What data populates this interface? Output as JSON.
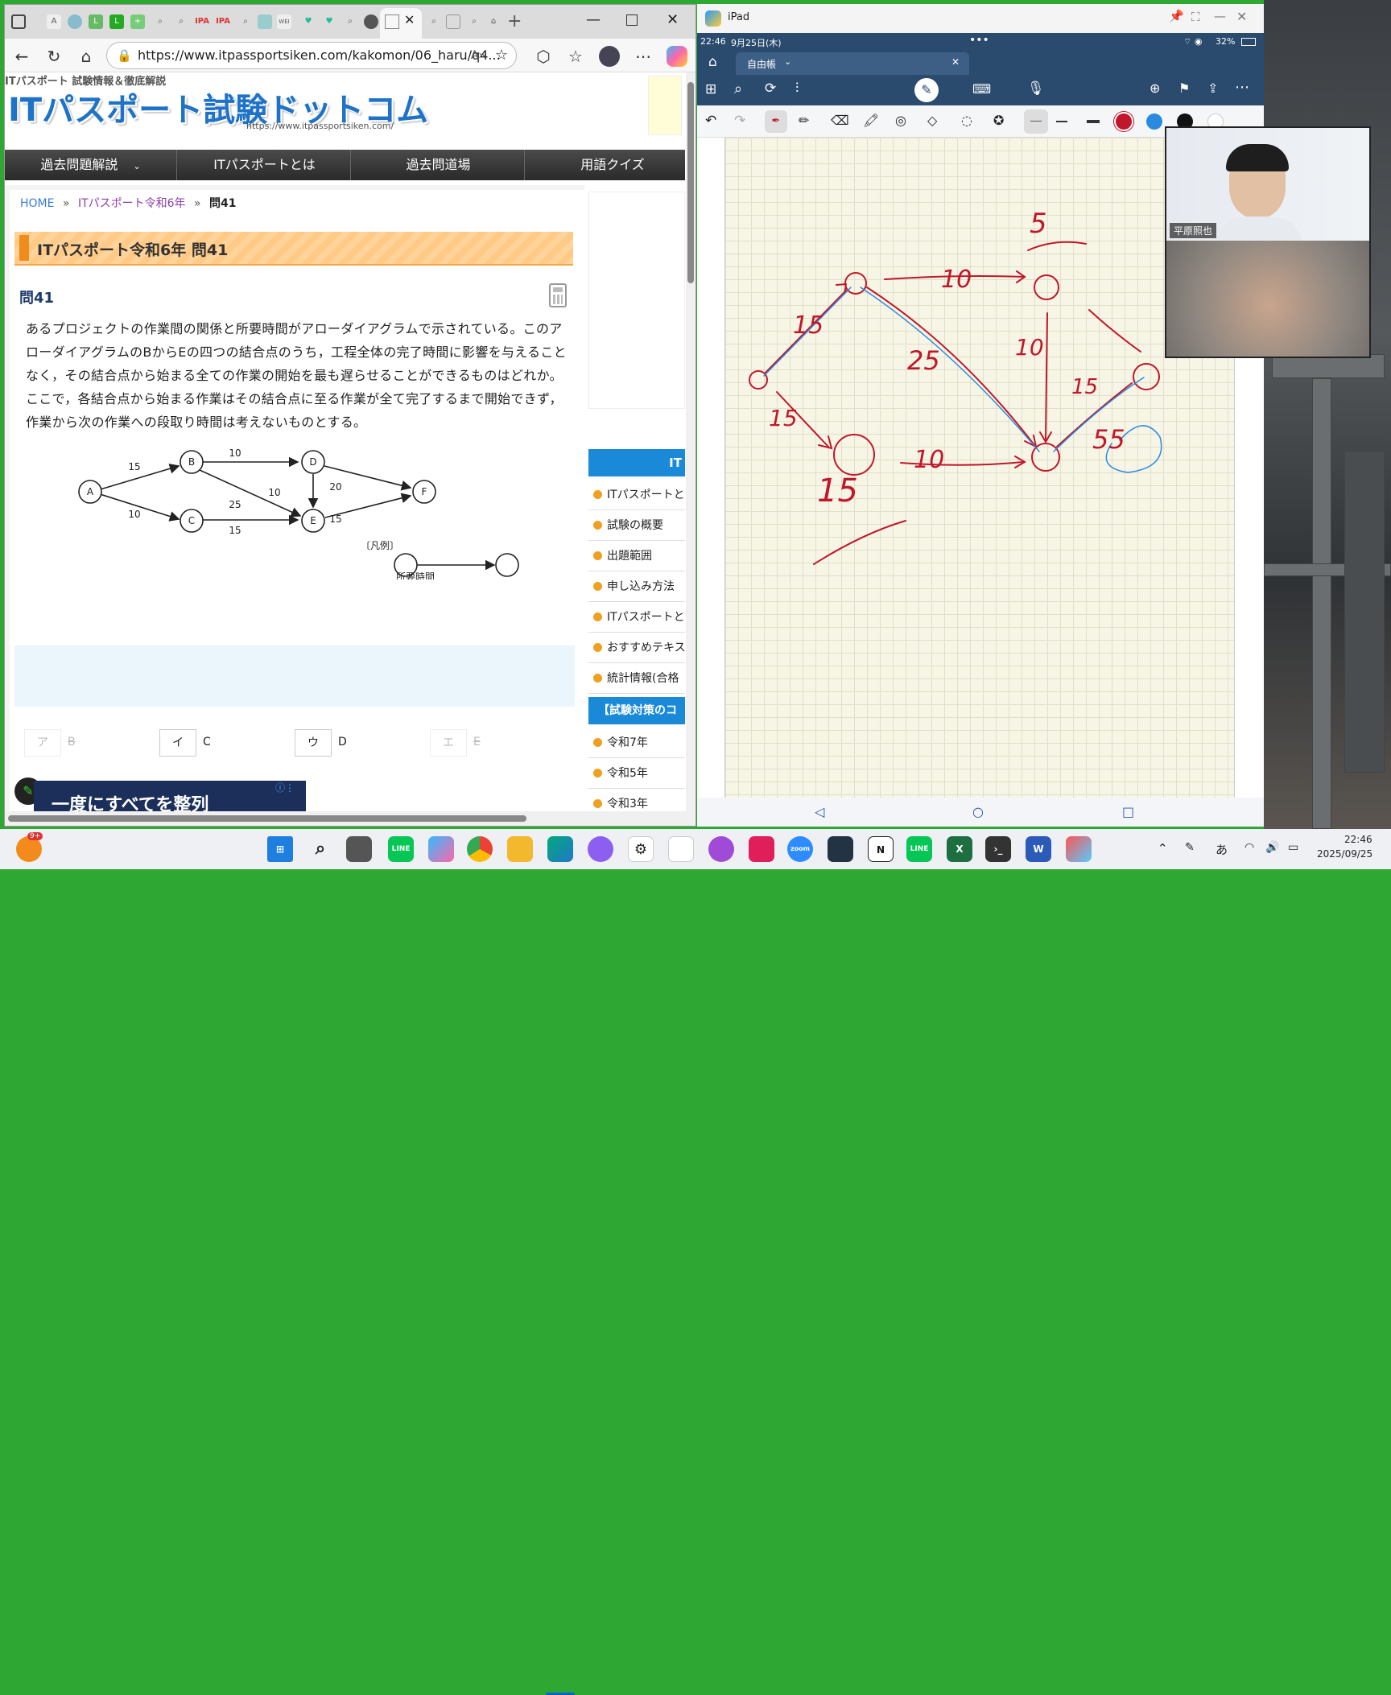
{
  "browser": {
    "url": "https://www.itpassportsiken.com/kakomon/06_haru/q4...",
    "tabs": [
      "A",
      "",
      "L",
      "L",
      "",
      "",
      "",
      "IPA",
      "IPA",
      "",
      "",
      "WEI",
      "",
      "",
      "",
      "",
      "",
      "",
      "",
      "",
      "",
      "",
      ""
    ]
  },
  "site": {
    "tagline": "ITパスポート 試験情報＆徹底解説",
    "logo": "ITパスポート試験ドットコム",
    "logo_url": "https://www.itpassportsiken.com/",
    "nav": [
      "過去問題解説",
      "ITパスポートとは",
      "過去問道場",
      "用語クイズ"
    ],
    "breadcrumb": {
      "home": "HOME",
      "sep1": "»",
      "section": "ITパスポート令和6年",
      "sep2": "»",
      "current": "問41"
    },
    "heading": "ITパスポート令和6年 問41",
    "question_no": "問41",
    "question_text": "あるプロジェクトの作業間の関係と所要時間がアローダイアグラムで示されている。このアローダイアグラムのBからEの四つの結合点のうち，工程全体の完了時間に影響を与えることなく，その結合点から始まる全ての作業の開始を最も遅らせることができるものはどれか。ここで，各結合点から始まる作業はその結合点に至る作業が全て完了するまで開始できず，作業から次の作業への段取り時間は考えないものとする。",
    "diagram": {
      "nodes": [
        "A",
        "B",
        "C",
        "D",
        "E",
        "F"
      ],
      "edges": [
        {
          "from": "A",
          "to": "B",
          "label": "15"
        },
        {
          "from": "A",
          "to": "C",
          "label": "10"
        },
        {
          "from": "B",
          "to": "D",
          "label": "10"
        },
        {
          "from": "B",
          "to": "E",
          "label": "25"
        },
        {
          "from": "C",
          "to": "E",
          "label": "15"
        },
        {
          "from": "D",
          "to": "E",
          "label": "10"
        },
        {
          "from": "D",
          "to": "F",
          "label": "20"
        },
        {
          "from": "E",
          "to": "F",
          "label": "15"
        }
      ],
      "legend_title": "〔凡例〕",
      "legend_label": "所要時間"
    },
    "choices": [
      {
        "key": "ア",
        "label": "B"
      },
      {
        "key": "イ",
        "label": "C"
      },
      {
        "key": "ウ",
        "label": "D"
      },
      {
        "key": "エ",
        "label": "E"
      }
    ],
    "sidebar_head": "IT",
    "sidebar_items": [
      "ITパスポートと",
      "試験の概要",
      "出題範囲",
      "申し込み方法",
      "ITパスポートと",
      "おすすめテキス",
      "統計情報(合格"
    ],
    "sidebar_head2": "【試験対策のコ",
    "sidebar_items2": [
      "令和7年",
      "令和5年",
      "令和3年"
    ],
    "ad_text": "一度にすべてを整列"
  },
  "ipad": {
    "window_title": "iPad",
    "time": "22:46",
    "date": "9月25日(木)",
    "battery": "32%",
    "tab": "自由帳",
    "note_labels": {
      "n1": "15",
      "n2": "10",
      "n3": "5",
      "n4": "25",
      "n5": "10",
      "n6": "15",
      "n7": "10",
      "n8": "15",
      "n9": "15",
      "n10": "55"
    },
    "participant": "平原照也"
  },
  "taskbar": {
    "badge": "9+",
    "time": "22:46",
    "date": "2025/09/25",
    "ime": "あ"
  },
  "colors": {
    "accent": "#f1a94a",
    "ink_red": "#c0172b",
    "ink_blue": "#2a8ae0",
    "nav_dark": "#3b3b3b"
  }
}
